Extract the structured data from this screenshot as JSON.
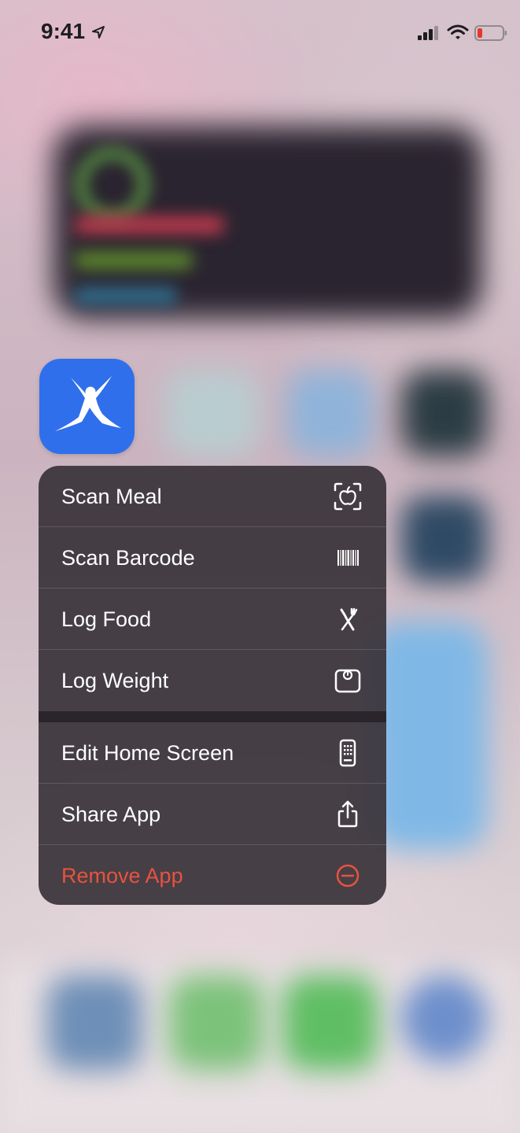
{
  "status_bar": {
    "time": "9:41",
    "icons": [
      "location-arrow-icon",
      "cellular-signal-icon",
      "wifi-icon",
      "battery-low-icon"
    ],
    "battery_color": "#e5372e"
  },
  "app": {
    "icon_name": "myfitnesspal-app-icon",
    "icon_color": "#2f6fec"
  },
  "context_menu": {
    "app_actions": [
      {
        "label": "Scan Meal",
        "icon": "scan-meal-icon"
      },
      {
        "label": "Scan Barcode",
        "icon": "barcode-icon"
      },
      {
        "label": "Log Food",
        "icon": "fork-knife-icon"
      },
      {
        "label": "Log Weight",
        "icon": "scale-icon"
      }
    ],
    "system_actions": [
      {
        "label": "Edit Home Screen",
        "icon": "phone-screen-icon"
      },
      {
        "label": "Share App",
        "icon": "share-icon"
      },
      {
        "label": "Remove App",
        "icon": "minus-circle-icon",
        "destructive": true
      }
    ],
    "destructive_color": "#e8523f"
  }
}
